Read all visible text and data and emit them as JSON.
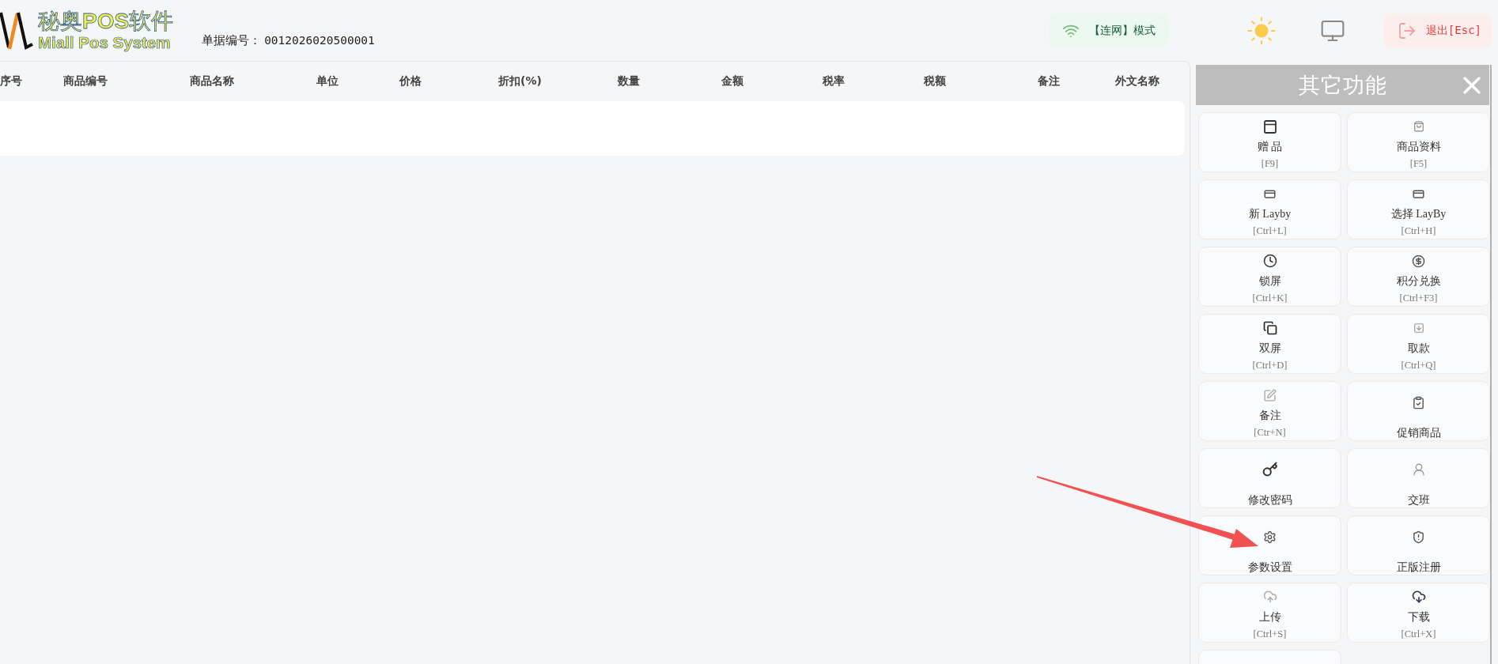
{
  "header": {
    "logo": {
      "title": "秘奥POS软件",
      "subtitle": "Miall Pos System"
    },
    "document_number": {
      "label": "单据编号：",
      "value": "0012026020500001"
    },
    "network_mode": "【连网】模式",
    "exit_button": "退出[Esc]"
  },
  "table": {
    "columns": [
      "序号",
      "商品编号",
      "商品名称",
      "单位",
      "价格",
      "折扣(%)",
      "数量",
      "金额",
      "税率",
      "税额",
      "备注",
      "外文名称"
    ]
  },
  "side_panel": {
    "title": "其它功能",
    "items": [
      {
        "label": "赠 品",
        "shortcut": "[F9]"
      },
      {
        "label": "商品资料",
        "shortcut": "[F5]"
      },
      {
        "label": "新 Layby",
        "shortcut": "[Ctrl+L]"
      },
      {
        "label": "选择 LayBy",
        "shortcut": "[Ctrl+H]"
      },
      {
        "label": "锁屏",
        "shortcut": "[Ctrl+K]"
      },
      {
        "label": "积分兑换",
        "shortcut": "[Ctrl+F3]"
      },
      {
        "label": "双屏",
        "shortcut": "[Ctrl+D]"
      },
      {
        "label": "取款",
        "shortcut": "[Ctrl+Q]"
      },
      {
        "label": "备注",
        "shortcut": "[Ctr+N]"
      },
      {
        "label": "促销商品"
      },
      {
        "label": "修改密码"
      },
      {
        "label": "交班"
      },
      {
        "label": "参数设置"
      },
      {
        "label": "正版注册"
      },
      {
        "label": "上传",
        "shortcut": "[Ctrl+S]"
      },
      {
        "label": "下载",
        "shortcut": "[Ctrl+X]"
      }
    ]
  },
  "annotations": [
    {
      "kind": "arrow"
    }
  ]
}
